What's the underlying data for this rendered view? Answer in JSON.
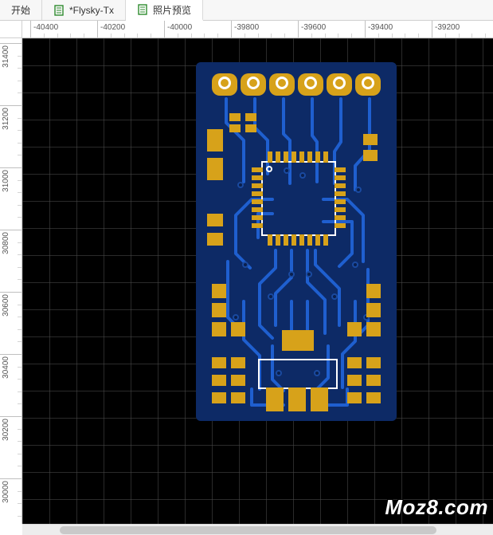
{
  "tabs": [
    {
      "label": "开始",
      "icon": "none"
    },
    {
      "label": "*Flysky-Tx",
      "icon": "doc"
    },
    {
      "label": "照片预览",
      "icon": "doc"
    }
  ],
  "active_tab_index": 2,
  "ruler_h": {
    "labels": [
      "-40400",
      "-40200",
      "-40000",
      "-39800",
      "-39600",
      "-39400",
      "-39200"
    ]
  },
  "ruler_v": {
    "labels": [
      "31400",
      "31200",
      "31000",
      "30800",
      "30600",
      "30400",
      "30200",
      "30000"
    ]
  },
  "watermark": "Moz8.com",
  "colors": {
    "pcb_solder": "#0d2a66",
    "copper": "#d7a21a",
    "silk": "#ffffff",
    "canvas_bg": "#000000"
  }
}
